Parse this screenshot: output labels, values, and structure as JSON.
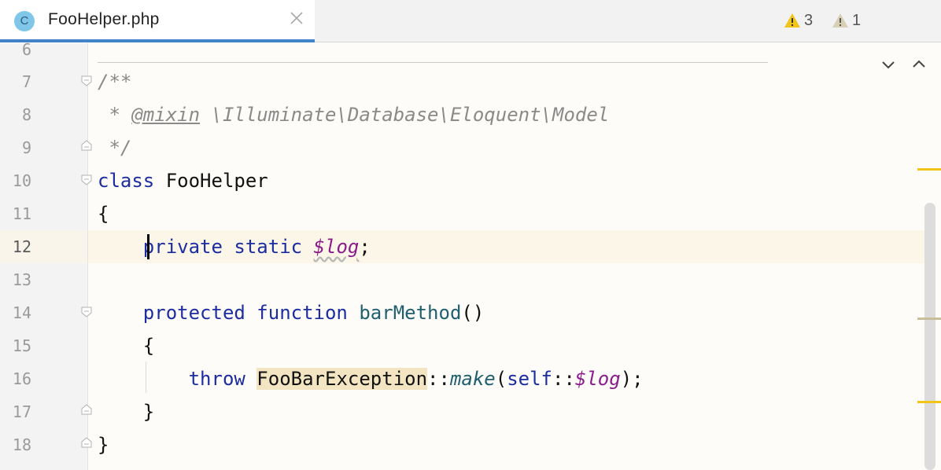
{
  "tab": {
    "icon_letter": "C",
    "title": "FooHelper.php",
    "icon": "php-class-icon"
  },
  "inspections": {
    "warnings": "3",
    "weak_warnings": "1"
  },
  "line_numbers": [
    "6",
    "7",
    "8",
    "9",
    "10",
    "11",
    "12",
    "13",
    "14",
    "15",
    "16",
    "17",
    "18"
  ],
  "code": {
    "l7": "/**",
    "l8_star": " * ",
    "l8_tag": "@mixin",
    "l8_rest": " \\Illuminate\\Database\\Eloquent\\Model",
    "l9": " */",
    "l10_kw": "class",
    "l10_name": " FooHelper",
    "l11": "{",
    "l12_indent": "    ",
    "l12_kw": "private static",
    "l12_sp": " ",
    "l12_var": "$log",
    "l12_end": ";",
    "l14_indent": "    ",
    "l14_kw": "protected function",
    "l14_sp": " ",
    "l14_fn": "barMethod",
    "l14_end": "()",
    "l15": "    {",
    "l16_indent": "        ",
    "l16_kw": "throw",
    "l16_sp": " ",
    "l16_cls": "FooBarException",
    "l16_sep": "::",
    "l16_fn": "make",
    "l16_open": "(",
    "l16_self": "self",
    "l16_sep2": "::",
    "l16_var": "$log",
    "l16_close": ");",
    "l17": "    }",
    "l18": "}"
  },
  "colors": {
    "warning": "#f0c419",
    "weak_warning": "#d9cfb4",
    "tab_underline": "#4083c9"
  }
}
